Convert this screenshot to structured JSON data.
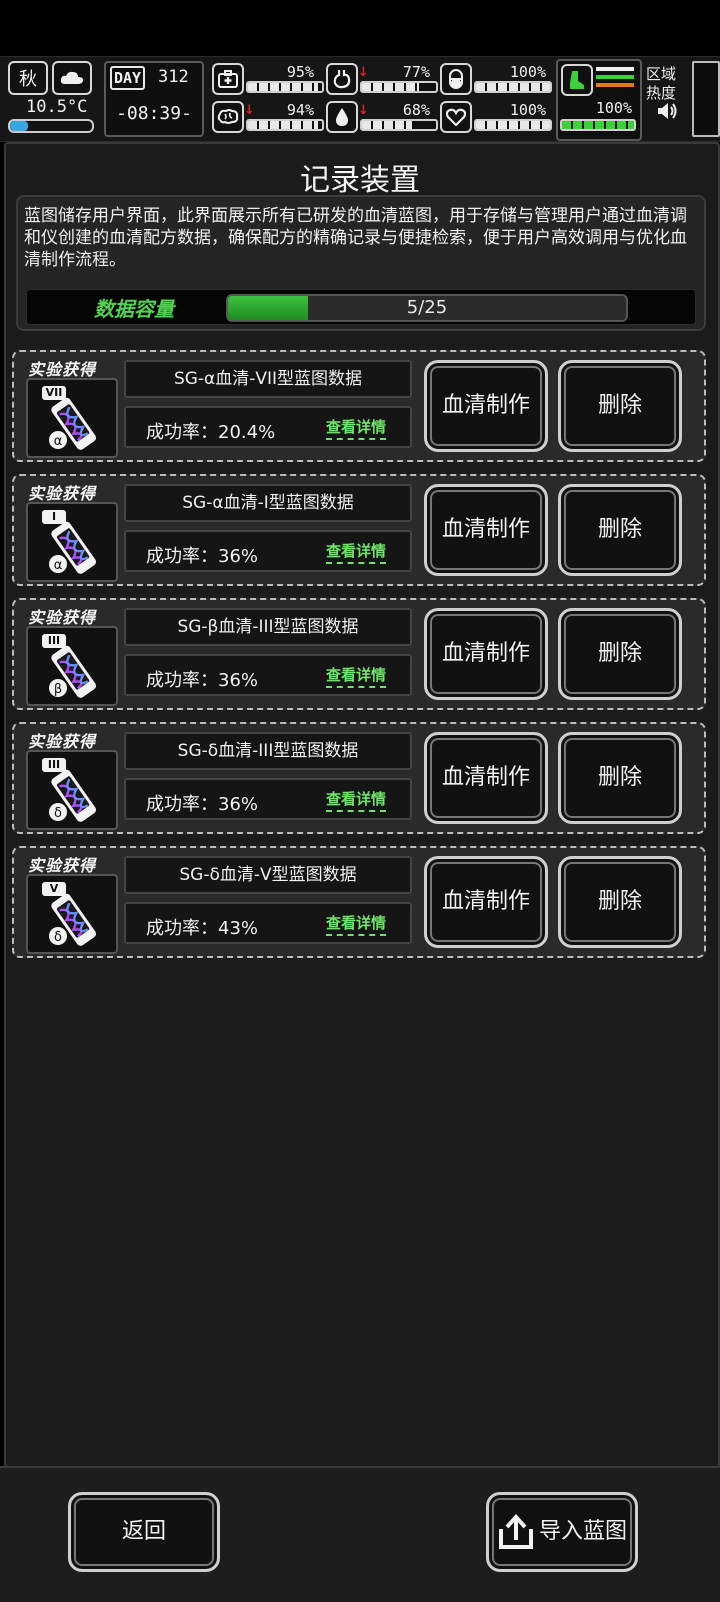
{
  "hud": {
    "season": "秋",
    "temperature": "10.5°C",
    "day_label": "DAY",
    "day_number": "312",
    "time": "-08:39-",
    "stats": [
      {
        "name": "health",
        "value": "95%",
        "level": 0.95,
        "arrow": false
      },
      {
        "name": "stomach",
        "value": "77%",
        "level": 0.77,
        "arrow": true
      },
      {
        "name": "pill",
        "value": "100%",
        "level": 1.0,
        "arrow": false
      },
      {
        "name": "brain",
        "value": "94%",
        "level": 0.94,
        "arrow": true
      },
      {
        "name": "water",
        "value": "68%",
        "level": 0.68,
        "arrow": true
      },
      {
        "name": "heart",
        "value": "100%",
        "level": 1.0,
        "arrow": false
      }
    ],
    "stamina": "100%",
    "stamina_level": 1.0,
    "zone_label": "区域\n热度"
  },
  "page": {
    "title": "记录装置",
    "description": "蓝图储存用户界面，此界面展示所有已研发的血清蓝图，用于存储与管理用户通过血清调和仪创建的血清配方数据，确保配方的精确记录与便捷检索，便于用户高效调用与优化血清制作流程。",
    "capacity_label": "数据容量",
    "capacity_text": "5/25",
    "capacity_used": 5,
    "capacity_total": 25
  },
  "blueprints": [
    {
      "tag": "实验获得",
      "roman": "VII",
      "greek": "α",
      "name": "SG-α血清-VII型蓝图数据",
      "rate": "成功率：20.4%",
      "detail": "查看详情",
      "make": "血清制作",
      "delete": "删除"
    },
    {
      "tag": "实验获得",
      "roman": "I",
      "greek": "α",
      "name": "SG-α血清-I型蓝图数据",
      "rate": "成功率：36%",
      "detail": "查看详情",
      "make": "血清制作",
      "delete": "删除"
    },
    {
      "tag": "实验获得",
      "roman": "III",
      "greek": "β",
      "name": "SG-β血清-III型蓝图数据",
      "rate": "成功率：36%",
      "detail": "查看详情",
      "make": "血清制作",
      "delete": "删除"
    },
    {
      "tag": "实验获得",
      "roman": "III",
      "greek": "δ",
      "name": "SG-δ血清-III型蓝图数据",
      "rate": "成功率：36%",
      "detail": "查看详情",
      "make": "血清制作",
      "delete": "删除"
    },
    {
      "tag": "实验获得",
      "roman": "V",
      "greek": "δ",
      "name": "SG-δ血清-V型蓝图数据",
      "rate": "成功率：43%",
      "detail": "查看详情",
      "make": "血清制作",
      "delete": "删除"
    }
  ],
  "footer": {
    "back_label": "返回",
    "import_label": "导入蓝图"
  },
  "colors": {
    "accent_green": "#52d24f",
    "detail_green": "#6fe26a",
    "alert_red": "#e02020"
  }
}
